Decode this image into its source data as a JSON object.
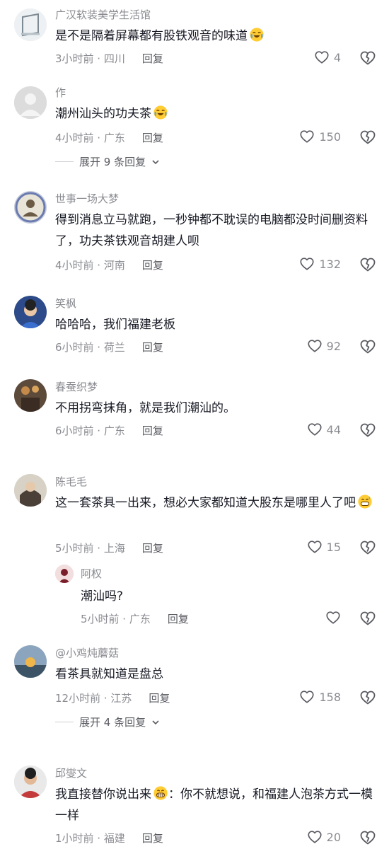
{
  "comments": [
    {
      "user": "广汉软装美学生活馆",
      "text": "是不是隔着屏幕都有股铁观音的味道",
      "time": "3小时前 · 四川",
      "reply": "回复",
      "likes": "4",
      "emoji": "laugh-cry"
    },
    {
      "user": "作",
      "text": "潮州汕头的功夫茶",
      "time": "4小时前 · 广东",
      "reply": "回复",
      "likes": "150",
      "emoji": "laugh-cry",
      "expand": "展开 9 条回复"
    },
    {
      "user": "世事一场大梦",
      "text": "得到消息立马就跑，一秒钟都不耽误的电脑都没时间删资料了，功夫茶铁观音胡建人呗",
      "time": "4小时前 · 河南",
      "reply": "回复",
      "likes": "132"
    },
    {
      "user": "笑枫",
      "text": "哈哈哈，我们福建老板",
      "time": "6小时前 · 荷兰",
      "reply": "回复",
      "likes": "92"
    },
    {
      "user": "春蚕织梦",
      "text": "不用拐弯抹角，就是我们潮汕的。",
      "time": "6小时前 · 广东",
      "reply": "回复",
      "likes": "44"
    },
    {
      "user": "陈毛毛",
      "text": "这一套茶具一出来，想必大家都知道大股东是哪里人了吧",
      "time": "5小时前 · 上海",
      "reply": "回复",
      "likes": "15",
      "emoji": "grin-sweat",
      "sub": {
        "user": "阿权",
        "text": "潮汕吗?",
        "time": "5小时前 · 广东",
        "reply": "回复"
      }
    },
    {
      "user": "@小鸡炖蘑菇",
      "text": "看茶具就知道是盘总",
      "time": "12小时前 · 江苏",
      "reply": "回复",
      "likes": "158",
      "expand": "展开 4 条回复"
    },
    {
      "user": "邱燮文",
      "text_a": "我直接替你说出来",
      "text_b": "：你不就想说，和福建人泡茶方式一模一样",
      "time": "1小时前 · 福建",
      "reply": "回复",
      "likes": "20",
      "emoji": "grin"
    }
  ],
  "icons": {
    "like": "heart-outline-icon",
    "dislike": "broken-heart-icon",
    "expand": "chevron-down-icon"
  },
  "colors": {
    "text": "#161823",
    "secondary": "#8a8b91",
    "reply": "#5a5b62",
    "bg": "#ffffff"
  }
}
